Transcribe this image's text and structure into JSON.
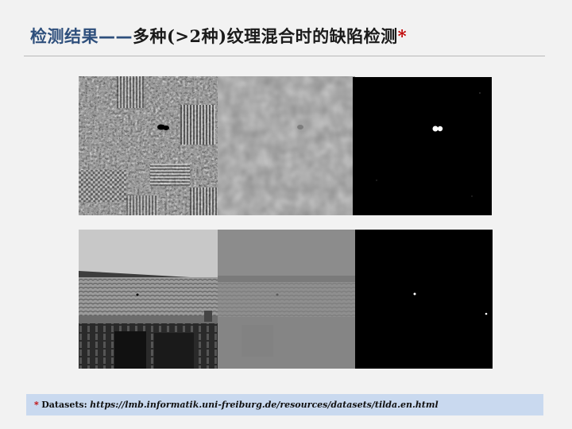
{
  "title": {
    "prefix": "检测结果——",
    "main": "多种(>2种)纹理混合时的缺陷检测",
    "asterisk": "*"
  },
  "figures": {
    "rows": [
      {
        "panels": [
          "texture-mosaic-input",
          "background-reconstruction",
          "defect-map"
        ]
      },
      {
        "panels": [
          "roof-scene-input",
          "background-reconstruction",
          "defect-map"
        ]
      }
    ]
  },
  "footnote": {
    "asterisk": "*",
    "label": "Datasets:",
    "url": "https://lmb.informatik.uni-freiburg.de/resources/datasets/tilda.en.html"
  },
  "colors": {
    "title_blue": "#2e4f7c",
    "accent_red": "#c00000",
    "footnote_bg": "#c9d9ef",
    "slide_bg": "#f2f2f2"
  }
}
